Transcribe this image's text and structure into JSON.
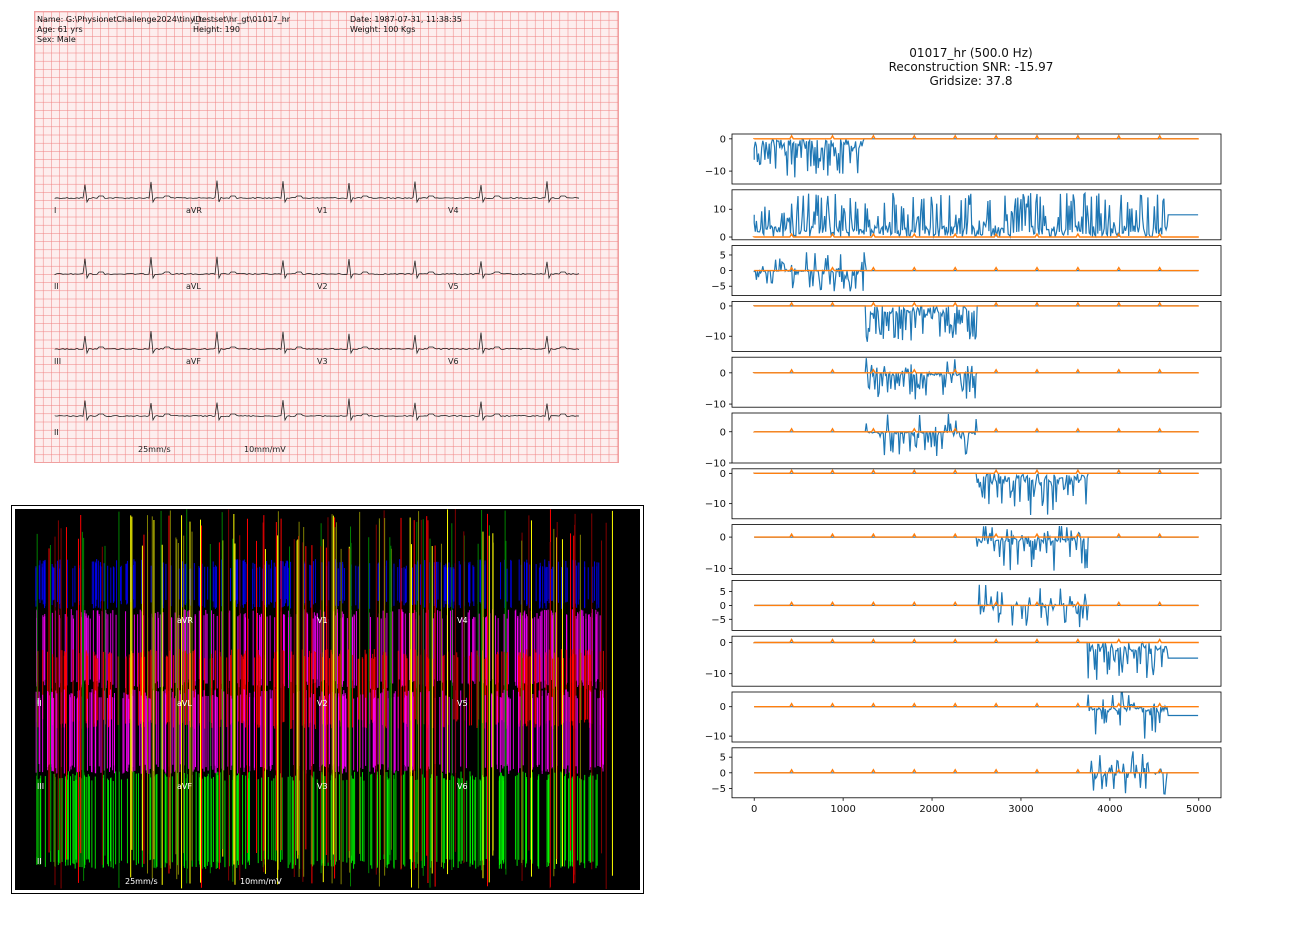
{
  "ecg_image": {
    "header": {
      "name": "Name: G:\\PhysionetChallenge2024\\tiny_testset\\hr_gt\\01017_hr",
      "id": "ID:",
      "date": "Date: 1987-07-31, 11:38:35",
      "age": "Age: 61 yrs",
      "height": "Height: 190",
      "weight": "Weight: 100 Kgs",
      "sex": "Sex: Male"
    },
    "leads": [
      "I",
      "aVR",
      "V1",
      "V4",
      "II",
      "aVL",
      "V2",
      "V5",
      "III",
      "aVF",
      "V3",
      "V6",
      "II"
    ],
    "paper_speed": "25mm/s",
    "gain": "10mm/mV",
    "grid_color": "#f08080",
    "background_color": "#fdeeee"
  },
  "mask_image": {
    "background_color": "#000000",
    "lead_labels": [
      "I",
      "aVR",
      "V1",
      "V4",
      "II",
      "aVL",
      "V2",
      "V5",
      "III",
      "aVF",
      "V3",
      "V6",
      "II"
    ],
    "footer_labels": [
      "25mm/s",
      "10mm/mV"
    ],
    "band_colors": [
      "#0000ff",
      "#ff00ff",
      "#ff0000",
      "#ff00ff",
      "#00ff00"
    ]
  },
  "chart_data": {
    "type": "line",
    "title": [
      "01017_hr (500.0 Hz)",
      "Reconstruction SNR: -15.97",
      "Gridsize: 37.8"
    ],
    "xlim": [
      0,
      5000
    ],
    "xticks": [
      "0",
      "1000",
      "2000",
      "3000",
      "4000",
      "5000"
    ],
    "series_colors": {
      "reconstruction": "#1f77b4",
      "ground_truth": "#ff7f0e"
    },
    "subplots": [
      {
        "yticks": [
          "0",
          "−10"
        ],
        "yvals": [
          0,
          -10
        ],
        "ylim": [
          -14,
          1.5
        ],
        "recon_start": 0,
        "recon_end": 1230,
        "recon_offset": -6.5,
        "end_offset": 0,
        "noise_min": -12,
        "noise_max": 0
      },
      {
        "yticks": [
          "10",
          "0"
        ],
        "yvals": [
          10,
          0
        ],
        "ylim": [
          -1,
          17
        ],
        "recon_start": 0,
        "recon_end": 4650,
        "recon_offset": 8,
        "end_offset": 8,
        "noise_min": 0,
        "noise_max": 16
      },
      {
        "yticks": [
          "5",
          "0",
          "−5"
        ],
        "yvals": [
          5,
          0,
          -5
        ],
        "ylim": [
          -8,
          8
        ],
        "recon_start": 0,
        "recon_end": 1250,
        "recon_offset": -0.5,
        "end_offset": 0,
        "noise_min": -7,
        "noise_max": 6
      },
      {
        "yticks": [
          "0",
          "−10"
        ],
        "yvals": [
          0,
          -10
        ],
        "ylim": [
          -15,
          1.5
        ],
        "recon_start": 1250,
        "recon_end": 2500,
        "recon_offset": 0,
        "end_offset": 0,
        "noise_min": -13,
        "noise_max": 0
      },
      {
        "yticks": [
          "0",
          "−10"
        ],
        "yvals": [
          0,
          -10
        ],
        "ylim": [
          -11,
          5
        ],
        "recon_start": 1250,
        "recon_end": 2500,
        "recon_offset": 0,
        "end_offset": 0,
        "noise_min": -9,
        "noise_max": 5
      },
      {
        "yticks": [
          "0",
          "−10"
        ],
        "yvals": [
          0,
          -10
        ],
        "ylim": [
          -10,
          6
        ],
        "recon_start": 1250,
        "recon_end": 2500,
        "recon_offset": 0,
        "end_offset": 0,
        "noise_min": -8,
        "noise_max": 6
      },
      {
        "yticks": [
          "0",
          "−10"
        ],
        "yvals": [
          0,
          -10
        ],
        "ylim": [
          -15,
          1.5
        ],
        "recon_start": 2500,
        "recon_end": 3750,
        "recon_offset": 0,
        "end_offset": 0,
        "noise_min": -14,
        "noise_max": 0
      },
      {
        "yticks": [
          "0",
          "−10"
        ],
        "yvals": [
          0,
          -10
        ],
        "ylim": [
          -12,
          4
        ],
        "recon_start": 2500,
        "recon_end": 3750,
        "recon_offset": 0,
        "end_offset": 0,
        "noise_min": -11,
        "noise_max": 4
      },
      {
        "yticks": [
          "5",
          "0",
          "−5"
        ],
        "yvals": [
          5,
          0,
          -5
        ],
        "ylim": [
          -9,
          9
        ],
        "recon_start": 2500,
        "recon_end": 3750,
        "recon_offset": 0,
        "end_offset": 0,
        "noise_min": -8,
        "noise_max": 8
      },
      {
        "yticks": [
          "0",
          "−10"
        ],
        "yvals": [
          0,
          -10
        ],
        "ylim": [
          -14,
          2
        ],
        "recon_start": 3750,
        "recon_end": 4650,
        "recon_offset": 0,
        "end_offset": -5,
        "noise_min": -12,
        "noise_max": 0
      },
      {
        "yticks": [
          "0",
          "−10"
        ],
        "yvals": [
          0,
          -10
        ],
        "ylim": [
          -12,
          5
        ],
        "recon_start": 3750,
        "recon_end": 4650,
        "recon_offset": 0,
        "end_offset": -3,
        "noise_min": -11,
        "noise_max": 5
      },
      {
        "yticks": [
          "5",
          "0",
          "−5"
        ],
        "yvals": [
          5,
          0,
          -5
        ],
        "ylim": [
          -8,
          8
        ],
        "recon_start": 3750,
        "recon_end": 4650,
        "recon_offset": 0,
        "end_offset": 0,
        "noise_min": -7,
        "noise_max": 7
      }
    ]
  }
}
